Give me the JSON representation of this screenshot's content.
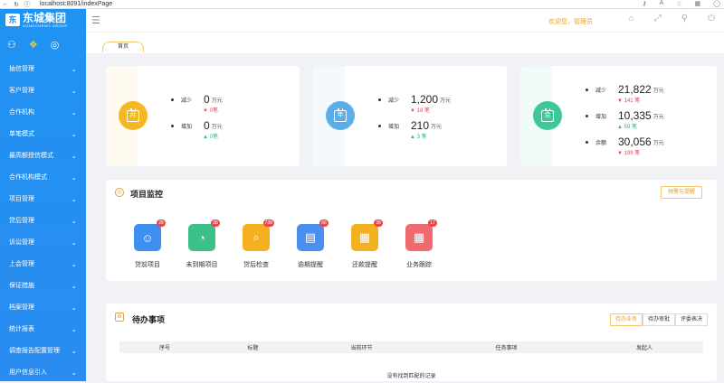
{
  "browser": {
    "url": "localhost:8091/indexPage"
  },
  "logo": {
    "name": "东城集团",
    "sub": "DONGCHENG GROUP"
  },
  "sidebar": {
    "items": [
      {
        "label": "抽信管理"
      },
      {
        "label": "客户管理"
      },
      {
        "label": "合作机构"
      },
      {
        "label": "单笔模式"
      },
      {
        "label": "最高额授信模式"
      },
      {
        "label": "合作机构模式"
      },
      {
        "label": "项目管理"
      },
      {
        "label": "贷后管理"
      },
      {
        "label": "诉讼管理"
      },
      {
        "label": "上会管理"
      },
      {
        "label": "保证措施"
      },
      {
        "label": "档案管理"
      },
      {
        "label": "统计报表"
      },
      {
        "label": "调查报告配置管理"
      },
      {
        "label": "用户信息引入"
      }
    ]
  },
  "header": {
    "welcome": "欢迎您，管理员"
  },
  "tabs": [
    {
      "label": "首页"
    }
  ],
  "stats": [
    {
      "icon_text": "月",
      "color": "#f5b823",
      "rows": [
        {
          "label": "减少",
          "value": "0",
          "unit": "万元",
          "delta": "0笔",
          "dir": "down"
        },
        {
          "label": "增加",
          "value": "0",
          "unit": "万元",
          "delta": "0笔",
          "dir": "up"
        }
      ]
    },
    {
      "icon_text": "年",
      "color": "#5aafe8",
      "rows": [
        {
          "label": "减少",
          "value": "1,200",
          "unit": "万元",
          "delta": "18 笔",
          "dir": "down"
        },
        {
          "label": "增加",
          "value": "210",
          "unit": "万元",
          "delta": "3 笔",
          "dir": "up"
        }
      ]
    },
    {
      "icon_text": "合",
      "color": "#3ec89a",
      "rows": [
        {
          "label": "减少",
          "value": "21,822",
          "unit": "万元",
          "delta": "141 笔",
          "dir": "down"
        },
        {
          "label": "增加",
          "value": "10,335",
          "unit": "万元",
          "delta": "59 笔",
          "dir": "up"
        },
        {
          "label": "余额",
          "value": "30,056",
          "unit": "万元",
          "delta": "199 笔",
          "dir": "down"
        }
      ]
    }
  ],
  "monitor": {
    "title": "项目监控",
    "warn_button": "预警与提醒",
    "modules": [
      {
        "label": "贷前项目",
        "badge": "28",
        "color": "#3d8ff0",
        "icon": "user-icon"
      },
      {
        "label": "未到期项目",
        "badge": "38",
        "color": "#3cc08a",
        "icon": "timer-icon"
      },
      {
        "label": "贷后检查",
        "badge": "738",
        "color": "#f5b020",
        "icon": "search-doc-icon"
      },
      {
        "label": "逾期提醒",
        "badge": "66",
        "color": "#4a8ff0",
        "icon": "doc-stack-icon"
      },
      {
        "label": "还款提醒",
        "badge": "38",
        "color": "#f5b020",
        "icon": "calendar-icon"
      },
      {
        "label": "业务跟踪",
        "badge": "17",
        "color": "#f06b70",
        "icon": "calendar-icon"
      }
    ]
  },
  "todo": {
    "title": "待办事项",
    "tabs": [
      "待办业务",
      "待办审批",
      "评委表决"
    ],
    "columns": [
      "序号",
      "标题",
      "当前环节",
      "任务事项",
      "发起人"
    ],
    "empty": "没有找到匹配的记录"
  }
}
